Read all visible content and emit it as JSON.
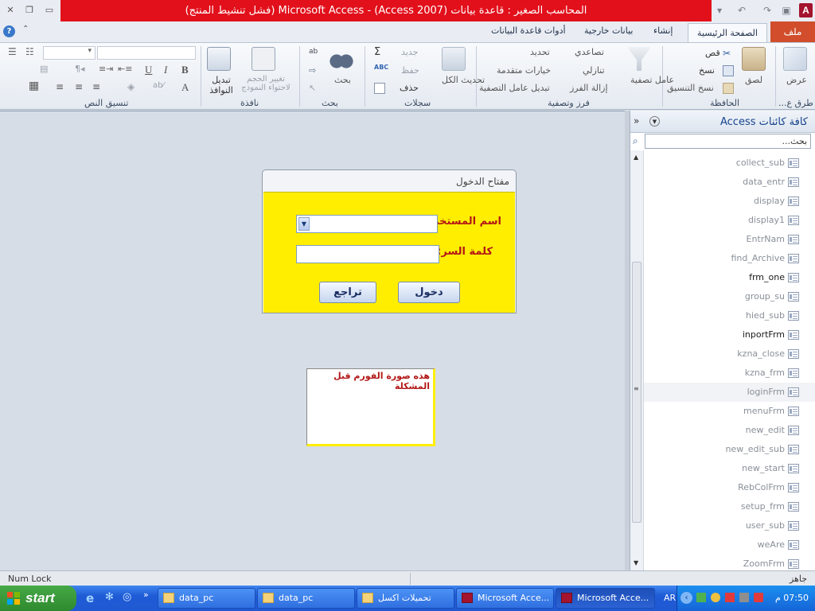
{
  "window": {
    "title": "المحاسب الصغير : قاعدة بيانات (Access 2007) - Microsoft Access (فشل تنشيط المنتج)",
    "app_icon_letter": "A"
  },
  "tabs": {
    "file": "ملف",
    "home": "الصفحة الرئيسية",
    "create": "إنشاء",
    "external": "بيانات خارجية",
    "dbtools": "أدوات قاعدة البيانات"
  },
  "ribbon": {
    "views": {
      "label": "عرض",
      "group": "طرق ع..."
    },
    "clipboard": {
      "group": "الحافظة",
      "paste": "لصق",
      "cut": "قص",
      "copy": "نسخ",
      "format_painter": "نسخ التنسيق"
    },
    "sort_filter": {
      "group": "فرز وتصفية",
      "filter": "عامل تصفية",
      "ascending": "تصاعدي",
      "descending": "تنازلي",
      "remove_sort": "إزالة الفرز",
      "selection": "تحديد",
      "advanced": "خيارات متقدمة",
      "toggle_filter": "تبديل عامل التصفية"
    },
    "records": {
      "group": "سجلات",
      "refresh_all": "تحديث الكل",
      "new": "جديد",
      "save": "حفظ",
      "delete": "حذف"
    },
    "find": {
      "group": "بحث",
      "find": "بحث"
    },
    "window": {
      "group": "نافذة",
      "size_to_fit": "تغيير الحجم لاحتواء النموذج",
      "switch_windows": "تبديل النوافذ"
    },
    "text_format": {
      "group": "تنسيق النص"
    }
  },
  "login_dialog": {
    "title": "مفتاح الدخول",
    "username_label": "اسم المستخدم:",
    "username_value": "",
    "password_label": "كلمة السر:",
    "password_value": "",
    "enter_button": "دخول",
    "back_button": "تراجع"
  },
  "note": {
    "text": "هذه صورة الفورم قبل المشكلة"
  },
  "nav_pane": {
    "title": "كافة كائنات Access",
    "search_placeholder": "بحث...",
    "items": [
      {
        "label": "collect_sub",
        "bold": false
      },
      {
        "label": "data_entr",
        "bold": false
      },
      {
        "label": "display",
        "bold": false
      },
      {
        "label": "display1",
        "bold": false
      },
      {
        "label": "EntrNam",
        "bold": false
      },
      {
        "label": "find_Archive",
        "bold": false
      },
      {
        "label": "frm_one",
        "bold": true
      },
      {
        "label": "group_su",
        "bold": false
      },
      {
        "label": "hied_sub",
        "bold": false
      },
      {
        "label": "inportFrm",
        "bold": true
      },
      {
        "label": "kzna_close",
        "bold": false
      },
      {
        "label": "kzna_frm",
        "bold": false
      },
      {
        "label": "loginFrm",
        "bold": false
      },
      {
        "label": "menuFrm",
        "bold": false
      },
      {
        "label": "new_edit",
        "bold": false
      },
      {
        "label": "new_edit_sub",
        "bold": false
      },
      {
        "label": "new_start",
        "bold": false
      },
      {
        "label": "RebColFrm",
        "bold": false
      },
      {
        "label": "setup_frm",
        "bold": false
      },
      {
        "label": "user_sub",
        "bold": false
      },
      {
        "label": "weAre",
        "bold": false
      },
      {
        "label": "ZoomFrm",
        "bold": false
      }
    ]
  },
  "statusbar": {
    "left": "Num Lock",
    "right": "جاهز"
  },
  "taskbar": {
    "start": "start",
    "tasks": [
      "data_pc",
      "data_pc",
      "تحميلات اكسل",
      "Microsoft Acce...",
      "Microsoft Acce..."
    ],
    "lang": "AR",
    "clock": "07:50 م"
  },
  "colors": {
    "title_red": "#e2101b",
    "file_tab": "#d14d2c",
    "dialog_yellow": "#ffee00",
    "label_red": "#b31717",
    "taskbar_blue": "#2059d2",
    "start_green": "#3b9a3b"
  }
}
